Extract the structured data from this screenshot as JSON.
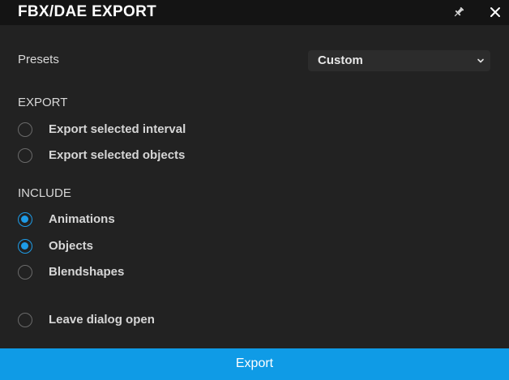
{
  "window": {
    "title": "FBX/DAE EXPORT",
    "pin_icon": "pin-icon",
    "close_icon": "close-icon"
  },
  "presets": {
    "label": "Presets",
    "selected": "Custom"
  },
  "export_section": {
    "heading": "EXPORT",
    "options": [
      {
        "label": "Export selected interval",
        "checked": false
      },
      {
        "label": "Export selected objects",
        "checked": false
      }
    ]
  },
  "include_section": {
    "heading": "INCLUDE",
    "options": [
      {
        "label": "Animations",
        "checked": true
      },
      {
        "label": "Objects",
        "checked": true
      },
      {
        "label": "Blendshapes",
        "checked": false
      }
    ]
  },
  "leave_open": {
    "label": "Leave dialog open",
    "checked": false
  },
  "footer": {
    "export_label": "Export"
  },
  "colors": {
    "accent": "#1e9be6",
    "button": "#0f9be6",
    "titlebar": "#141414",
    "panel": "#222222"
  }
}
